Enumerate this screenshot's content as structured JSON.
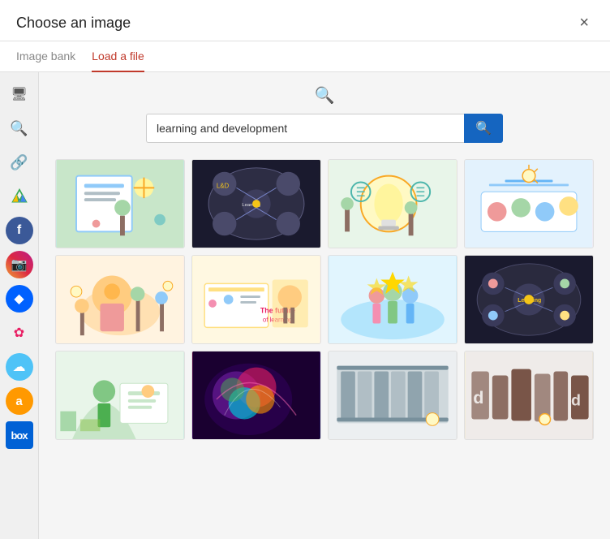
{
  "modal": {
    "title": "Choose an image",
    "close_label": "×"
  },
  "tabs": [
    {
      "id": "image-bank",
      "label": "Image bank",
      "active": false
    },
    {
      "id": "load-file",
      "label": "Load a file",
      "active": true
    }
  ],
  "search": {
    "placeholder": "learning and development",
    "value": "learning and development",
    "button_icon": "🔍"
  },
  "sidebar": {
    "icons": [
      {
        "id": "monitor",
        "symbol": "🖥",
        "label": "Monitor"
      },
      {
        "id": "search",
        "symbol": "🔍",
        "label": "Search"
      },
      {
        "id": "link",
        "symbol": "🔗",
        "label": "Link"
      },
      {
        "id": "google-drive",
        "symbol": "▲",
        "label": "Google Drive"
      },
      {
        "id": "facebook",
        "symbol": "f",
        "label": "Facebook"
      },
      {
        "id": "instagram",
        "symbol": "📷",
        "label": "Instagram"
      },
      {
        "id": "dropbox",
        "symbol": "◆",
        "label": "Dropbox"
      },
      {
        "id": "pinwheel",
        "symbol": "✿",
        "label": "Pinwheel"
      },
      {
        "id": "cloud",
        "symbol": "☁",
        "label": "Cloud"
      },
      {
        "id": "amazon",
        "symbol": "a",
        "label": "Amazon"
      },
      {
        "id": "box",
        "symbol": "□",
        "label": "Box"
      }
    ]
  },
  "images": [
    {
      "id": 1,
      "class": "img-1",
      "alt": "Learning illustration with book"
    },
    {
      "id": 2,
      "class": "img-2",
      "alt": "Team around table dark"
    },
    {
      "id": 3,
      "class": "img-3",
      "alt": "Brain lightbulb gears"
    },
    {
      "id": 4,
      "class": "img-4",
      "alt": "Team working illustration"
    },
    {
      "id": 5,
      "class": "img-5",
      "alt": "Learning development illustration orange"
    },
    {
      "id": 6,
      "class": "img-6",
      "alt": "Future of learning"
    },
    {
      "id": 7,
      "class": "img-7",
      "alt": "People stars blue"
    },
    {
      "id": 8,
      "class": "img-8",
      "alt": "Team table dark photo"
    },
    {
      "id": 9,
      "class": "img-9",
      "alt": "Teacher student green"
    },
    {
      "id": 10,
      "class": "img-10",
      "alt": "Colorful paint splash"
    },
    {
      "id": 11,
      "class": "img-11",
      "alt": "Library books grey"
    },
    {
      "id": 12,
      "class": "img-12",
      "alt": "Wooden letters"
    }
  ]
}
